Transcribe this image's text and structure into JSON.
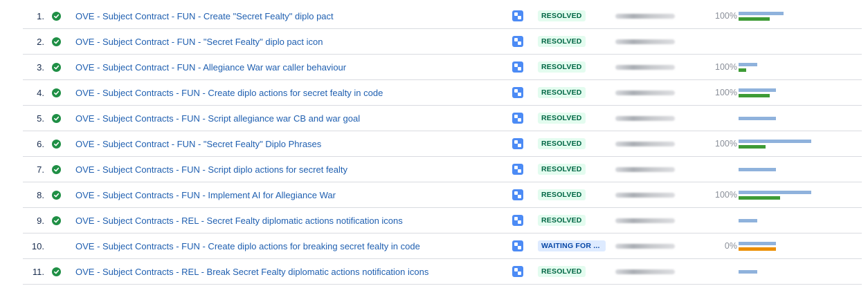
{
  "colors": {
    "link": "#1f5fb0",
    "resolved_bg": "#e3fcef",
    "resolved_fg": "#006644",
    "waiting_bg": "#deebff",
    "waiting_fg": "#0747a6",
    "check": "#1f8f45",
    "bar_estimate": "#8fb2dc",
    "bar_logged": "#3e9b36",
    "bar_none": "#ec8e00"
  },
  "rows": [
    {
      "num": "1.",
      "done": true,
      "summary": "OVE - Subject Contract - FUN - Create \"Secret Fealty\" diplo pact",
      "status": "RESOLVED",
      "status_kind": "resolved",
      "percent": "100%",
      "estimate_level": 0.62,
      "logged_level": 0.43,
      "logged_color": "green"
    },
    {
      "num": "2.",
      "done": true,
      "summary": "OVE - Subject Contract - FUN - \"Secret Fealty\" diplo pact icon",
      "status": "RESOLVED",
      "status_kind": "resolved",
      "percent": "",
      "estimate_level": 0,
      "logged_level": 0,
      "logged_color": "green"
    },
    {
      "num": "3.",
      "done": true,
      "summary": "OVE - Subject Contract - FUN - Allegiance War war caller behaviour",
      "status": "RESOLVED",
      "status_kind": "resolved",
      "percent": "100%",
      "estimate_level": 0.26,
      "logged_level": 0.1,
      "logged_color": "green"
    },
    {
      "num": "4.",
      "done": true,
      "summary": "OVE - Subject Contracts - FUN - Create diplo actions for secret fealty in code",
      "status": "RESOLVED",
      "status_kind": "resolved",
      "percent": "100%",
      "estimate_level": 0.51,
      "logged_level": 0.43,
      "logged_color": "green"
    },
    {
      "num": "5.",
      "done": true,
      "summary": "OVE - Subject Contracts - FUN - Script allegiance war CB and war goal",
      "status": "RESOLVED",
      "status_kind": "resolved",
      "percent": "",
      "estimate_level": 0.51,
      "logged_level": 0,
      "logged_color": "green"
    },
    {
      "num": "6.",
      "done": true,
      "summary": "OVE - Subject Contract - FUN - \"Secret Fealty\" Diplo Phrases",
      "status": "RESOLVED",
      "status_kind": "resolved",
      "percent": "100%",
      "estimate_level": 1.0,
      "logged_level": 0.37,
      "logged_color": "green"
    },
    {
      "num": "7.",
      "done": true,
      "summary": "OVE - Subject Contracts - FUN - Script diplo actions for secret fealty",
      "status": "RESOLVED",
      "status_kind": "resolved",
      "percent": "",
      "estimate_level": 0.51,
      "logged_level": 0,
      "logged_color": "green"
    },
    {
      "num": "8.",
      "done": true,
      "summary": "OVE - Subject Contracts - FUN - Implement AI for Allegiance War",
      "status": "RESOLVED",
      "status_kind": "resolved",
      "percent": "100%",
      "estimate_level": 1.0,
      "logged_level": 0.57,
      "logged_color": "green"
    },
    {
      "num": "9.",
      "done": true,
      "summary": "OVE - Subject Contracts - REL - Secret Fealty diplomatic actions notification icons",
      "status": "RESOLVED",
      "status_kind": "resolved",
      "percent": "",
      "estimate_level": 0.26,
      "logged_level": 0,
      "logged_color": "green"
    },
    {
      "num": "10.",
      "done": false,
      "summary": "OVE - Subject Contracts - FUN - Create diplo actions for breaking secret fealty in code",
      "status": "WAITING FOR ...",
      "status_kind": "waiting",
      "percent": "0%",
      "estimate_level": 0.51,
      "logged_level": 0.51,
      "logged_color": "orange"
    },
    {
      "num": "11.",
      "done": true,
      "summary": "OVE - Subject Contracts - REL - Break Secret Fealty diplomatic actions notification icons",
      "status": "RESOLVED",
      "status_kind": "resolved",
      "percent": "",
      "estimate_level": 0.26,
      "logged_level": 0,
      "logged_color": "green"
    }
  ]
}
